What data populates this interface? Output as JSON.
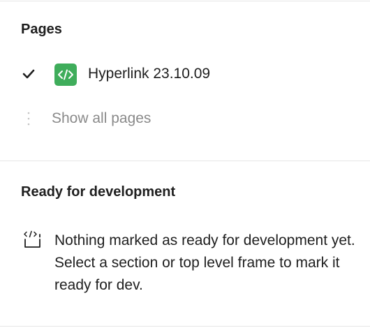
{
  "pages_section": {
    "title": "Pages",
    "current_page": {
      "label": "Hyperlink 23.10.09",
      "selected": true,
      "icon": "code-brackets-icon",
      "icon_color": "#3fad5b"
    },
    "show_all_label": "Show all pages"
  },
  "ready_section": {
    "title": "Ready for development",
    "icon": "dev-mode-frame-icon",
    "message": "Nothing marked as ready for development yet. Select a section or top level frame to mark it ready for dev."
  }
}
